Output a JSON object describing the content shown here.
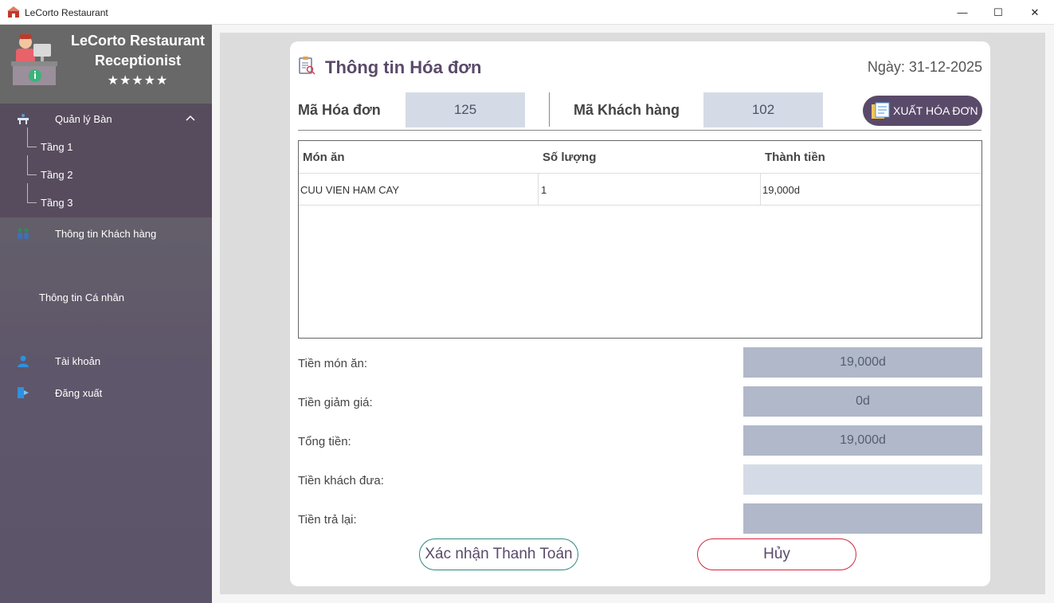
{
  "window": {
    "title": "LeCorto Restaurant",
    "min_glyph": "—",
    "max_glyph": "☐",
    "close_glyph": "✕"
  },
  "sidebar": {
    "brand_line1": "LeCorto Restaurant",
    "brand_line2": "Receptionist",
    "stars": "★★★★★",
    "menu": {
      "table_mgmt": "Quản lý Bàn",
      "floors": [
        "Tầng 1",
        "Tầng 2",
        "Tầng 3"
      ],
      "customer_info": "Thông tin Khách hàng",
      "personal_info": "Thông tin Cá nhân",
      "account": "Tài khoản",
      "logout": "Đăng xuất"
    }
  },
  "invoice": {
    "heading": "Thông tin Hóa đơn",
    "date": "Ngày: 31-12-2025",
    "invoice_id_label": "Mã Hóa đơn",
    "invoice_id": "125",
    "customer_id_label": "Mã Khách hàng",
    "customer_id": "102",
    "export_button": "XUẤT HÓA ĐƠN",
    "columns": [
      "Món ăn",
      "Số lượng",
      "Thành tiền"
    ],
    "rows": [
      [
        "CUU VIEN HAM CAY",
        "1",
        "19,000d"
      ]
    ],
    "summary": {
      "food_label": "Tiền món ăn:",
      "food_value": "19,000d",
      "discount_label": "Tiền giảm giá:",
      "discount_value": "0d",
      "total_label": "Tổng tiền:",
      "total_value": "19,000d",
      "given_label": "Tiền khách đưa:",
      "given_value": "",
      "change_label": "Tiền trả lại:",
      "change_value": ""
    },
    "confirm_button": "Xác nhận Thanh Toán",
    "cancel_button": "Hủy"
  },
  "colors": {
    "accent": "#5a4a6a",
    "confirm_border": "#2a8a82",
    "cancel_border": "#d4243e"
  }
}
